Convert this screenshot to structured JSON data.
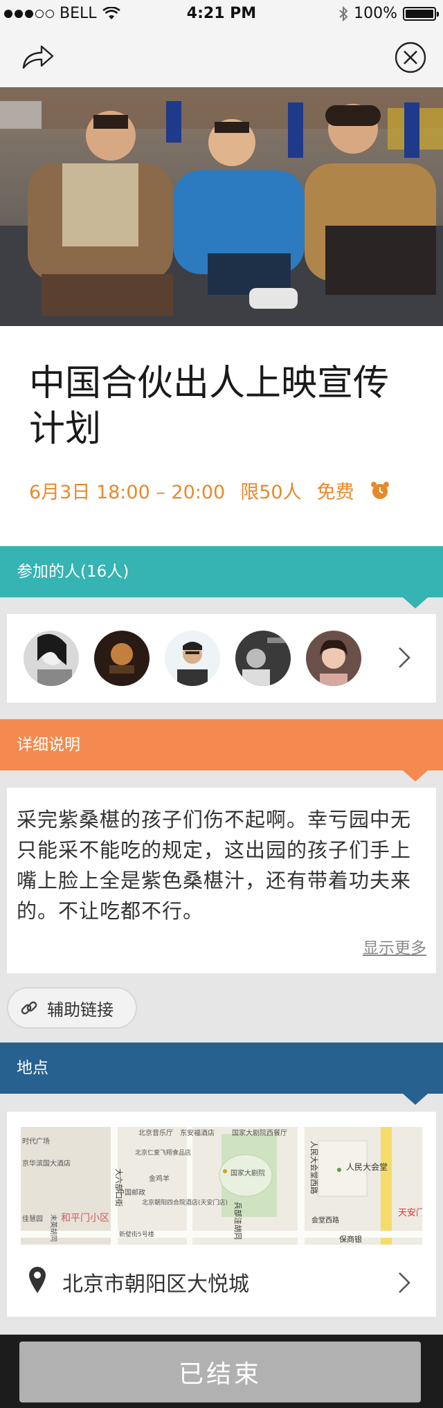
{
  "status_bar": {
    "carrier": "BELL",
    "time": "4:21 PM",
    "battery": "100%"
  },
  "event": {
    "title": "中国合伙出人上映宣传计划",
    "date_time": "6月3日 18:00 – 20:00",
    "limit": "限50人",
    "price": "免费"
  },
  "attendees": {
    "header": "参加的人(16人)"
  },
  "details": {
    "header": "详细说明",
    "text": "采完紫桑椹的孩子们伤不起啊。幸亏园中无只能采不能吃的规定，这出园的孩子们手上嘴上脸上全是紫色桑椹汁，还有带着功夫来的。不让吃都不行。",
    "show_more": "显示更多"
  },
  "aux_link": {
    "label": "辅助链接"
  },
  "location": {
    "header": "地点",
    "address": "北京市朝阳区大悦城",
    "map_labels": [
      "北京音乐厅",
      "东安福酒店",
      "国家大剧院西餐厅",
      "大六部口街",
      "北京仁爱飞翔食品店",
      "金鸡羊",
      "中国邮政",
      "国家大剧院",
      "人民大会堂西路",
      "人民大会堂",
      "北京朝阳四合院酒店(天安门店)",
      "兵部洼胡同",
      "会堂西路",
      "保商银",
      "天安门",
      "和平门小区",
      "新壁街5号楼",
      "时代广场",
      "京华滨国大酒店",
      "佳慧园",
      "未英胡同"
    ]
  },
  "footer": {
    "button": "已结束"
  },
  "colors": {
    "teal": "#36b3b3",
    "orange": "#f48a4f",
    "blue": "#27618f",
    "accent_orange": "#e8892b"
  }
}
